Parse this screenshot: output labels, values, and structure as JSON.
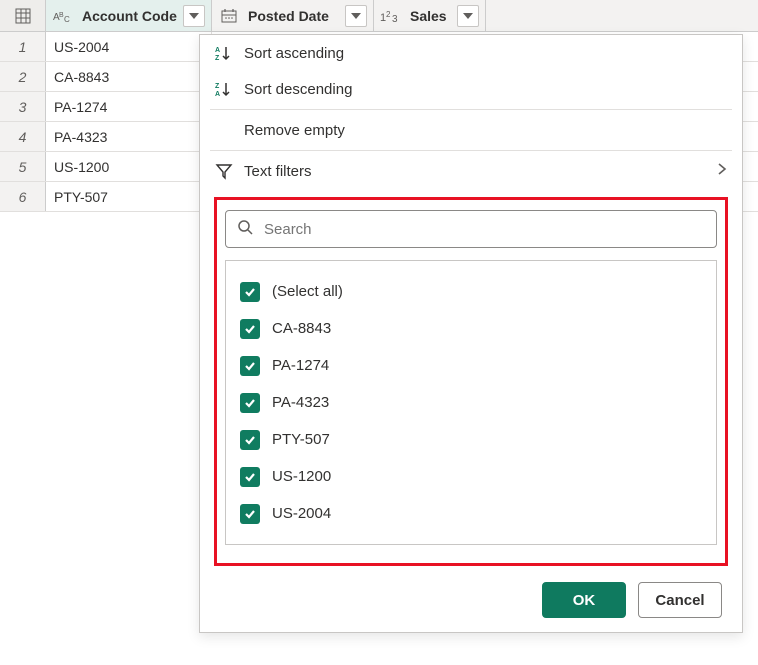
{
  "columns": {
    "account_code": "Account Code",
    "posted_date": "Posted Date",
    "sales": "Sales"
  },
  "rows": [
    {
      "idx": "1",
      "account_code": "US-2004"
    },
    {
      "idx": "2",
      "account_code": "CA-8843"
    },
    {
      "idx": "3",
      "account_code": "PA-1274"
    },
    {
      "idx": "4",
      "account_code": "PA-4323"
    },
    {
      "idx": "5",
      "account_code": "US-1200"
    },
    {
      "idx": "6",
      "account_code": "PTY-507"
    }
  ],
  "menu": {
    "sort_asc": "Sort ascending",
    "sort_desc": "Sort descending",
    "remove_empty": "Remove empty",
    "text_filters": "Text filters"
  },
  "search": {
    "placeholder": "Search"
  },
  "filter_values": [
    "(Select all)",
    "CA-8843",
    "PA-1274",
    "PA-4323",
    "PTY-507",
    "US-1200",
    "US-2004"
  ],
  "buttons": {
    "ok": "OK",
    "cancel": "Cancel"
  }
}
